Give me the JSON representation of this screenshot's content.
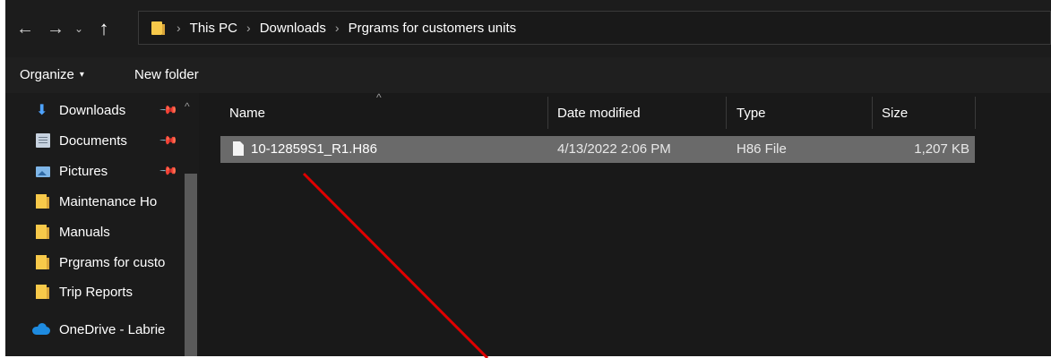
{
  "nav_buttons": {
    "back": "←",
    "forward": "→",
    "recent": "⌄",
    "up": "↑"
  },
  "address_bar": {
    "separator": "›",
    "crumbs": [
      "This PC",
      "Downloads",
      "Prgrams for customers units"
    ]
  },
  "toolbar": {
    "organize_label": "Organize",
    "organize_caret": "▾",
    "new_folder_label": "New folder"
  },
  "nav_pane": {
    "items": [
      {
        "label": "Downloads",
        "icon": "download-icon",
        "pinned": true
      },
      {
        "label": "Documents",
        "icon": "documents-icon",
        "pinned": true
      },
      {
        "label": "Pictures",
        "icon": "pictures-icon",
        "pinned": true
      },
      {
        "label": "Maintenance Ho",
        "icon": "folder-icon",
        "pinned": false
      },
      {
        "label": "Manuals",
        "icon": "folder-icon",
        "pinned": false
      },
      {
        "label": "Prgrams for custo",
        "icon": "folder-icon",
        "pinned": false
      },
      {
        "label": "Trip Reports",
        "icon": "folder-icon",
        "pinned": false
      },
      {
        "label": "OneDrive - Labrie",
        "icon": "onedrive-icon",
        "pinned": false
      }
    ],
    "pin_glyph": "📌",
    "scroll_up_glyph": "^"
  },
  "columns": {
    "name": "Name",
    "date_modified": "Date modified",
    "type": "Type",
    "size": "Size",
    "sort_caret": "^"
  },
  "files": [
    {
      "name": "10-12859S1_R1.H86",
      "date_modified": "4/13/2022 2:06 PM",
      "type": "H86 File",
      "size": "1,207 KB"
    }
  ],
  "colors": {
    "annotation_line": "#e00000",
    "selection": "#6a6a6a",
    "background": "#191919"
  }
}
